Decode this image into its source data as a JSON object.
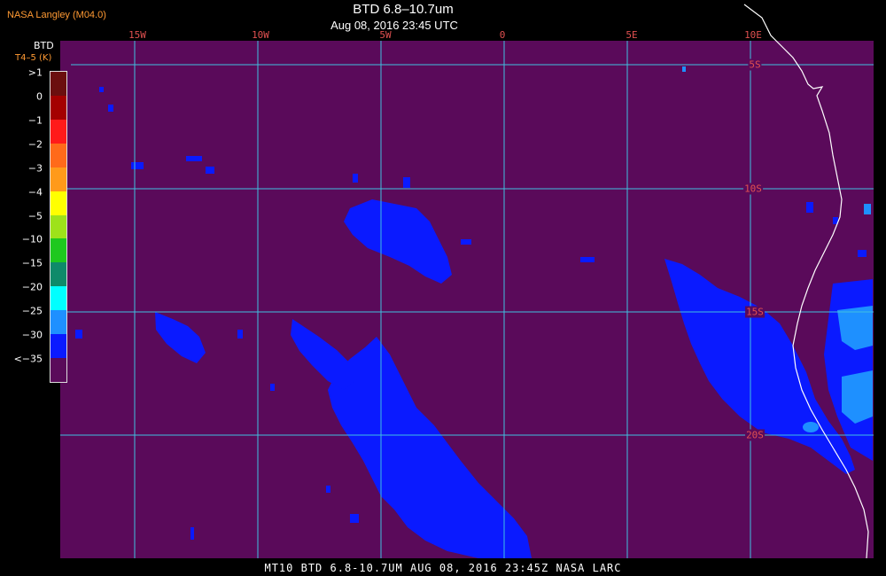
{
  "header": {
    "producer": "NASA Langley (M04.0)",
    "title": "BTD 6.8–10.7um",
    "datetime": "Aug 08, 2016 23:45 UTC"
  },
  "colorbar": {
    "title": "BTD",
    "subtitle": "T4–5 (K)",
    "entries": [
      {
        "label": ">1",
        "color": "#6b0f0f"
      },
      {
        "label": "0",
        "color": "#a40000"
      },
      {
        "label": "−1",
        "color": "#ff1a1a"
      },
      {
        "label": "−2",
        "color": "#ff6a1a"
      },
      {
        "label": "−3",
        "color": "#ff9a1a"
      },
      {
        "label": "−4",
        "color": "#ffff00"
      },
      {
        "label": "−5",
        "color": "#9ee21a"
      },
      {
        "label": "−10",
        "color": "#1ec81e"
      },
      {
        "label": "−15",
        "color": "#0e8a6a"
      },
      {
        "label": "−20",
        "color": "#00ffff"
      },
      {
        "label": "−25",
        "color": "#1e90ff"
      },
      {
        "label": "−30",
        "color": "#0a1aff"
      },
      {
        "label": "<−35",
        "color": "#5a0a5a"
      }
    ]
  },
  "grid": {
    "longitudes": [
      "15W",
      "10W",
      "5W",
      "0",
      "5E",
      "10E"
    ],
    "latitudes": [
      "5S",
      "10S",
      "15S",
      "20S"
    ]
  },
  "colors": {
    "background": "#5a0a5a",
    "grid": "#40c0e0",
    "blue_signal": "#0a1aff",
    "light_blue": "#1e90ff",
    "coast": "#ffffff",
    "label_red": "#e05050"
  },
  "footer": "MT10  BTD 6.8-10.7UM   AUG 08, 2016 23:45Z   NASA LARC"
}
